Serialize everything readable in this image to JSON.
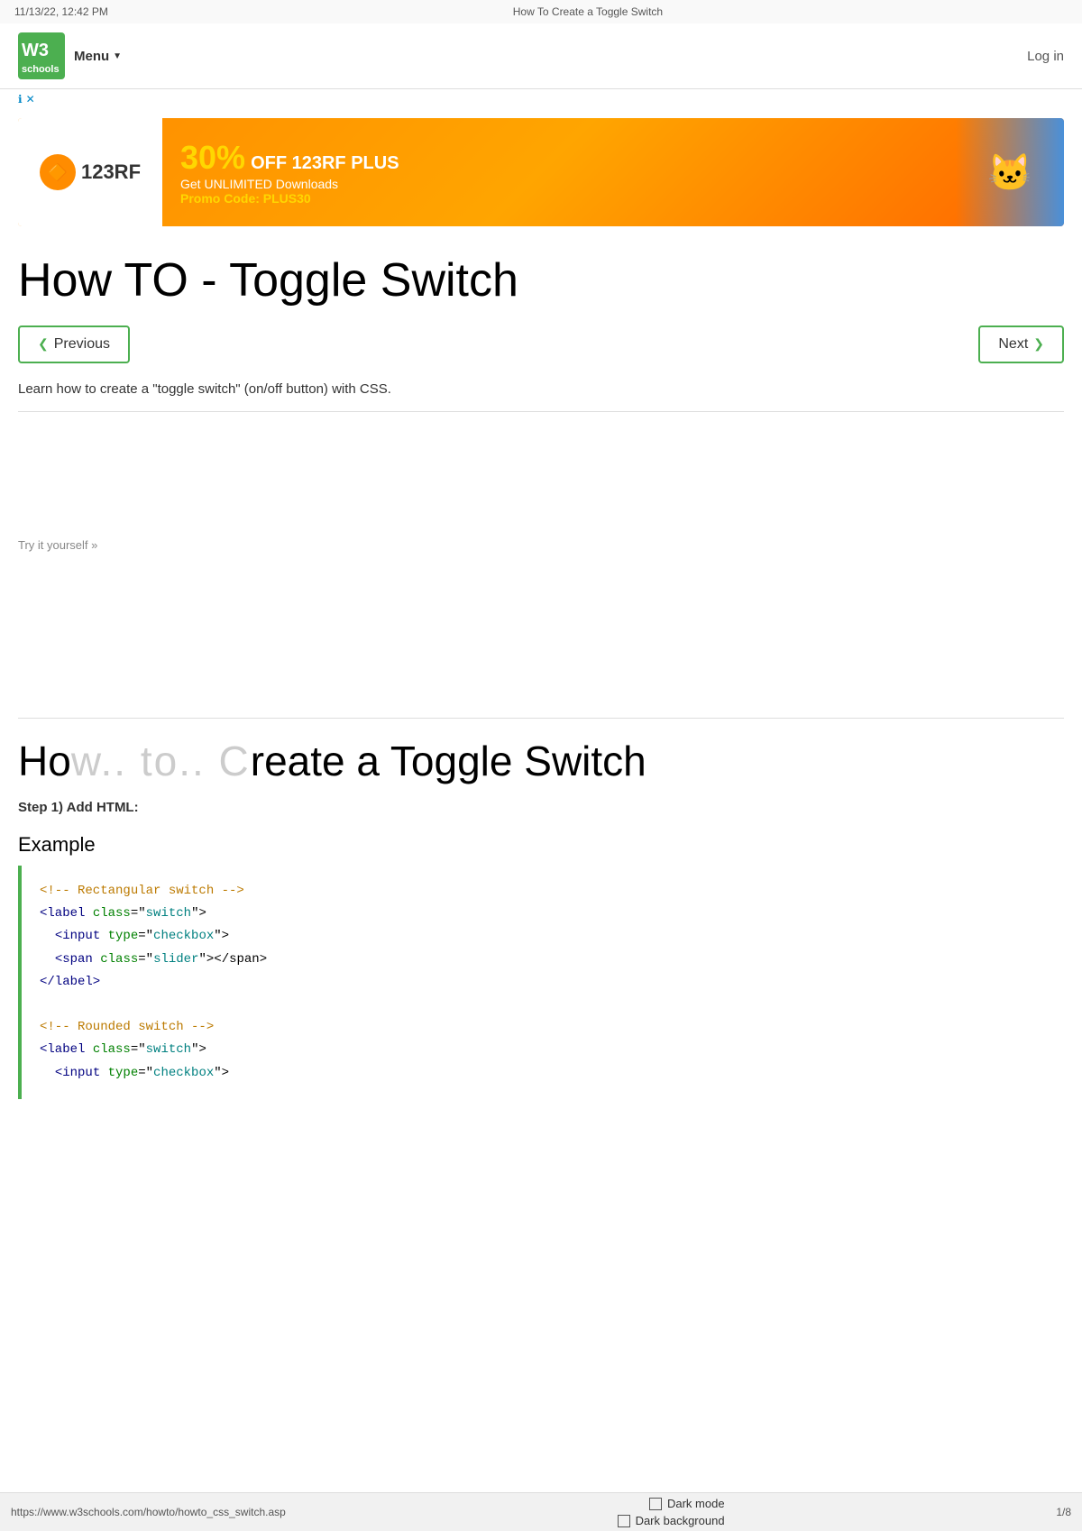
{
  "browser": {
    "date": "11/13/22, 12:42 PM",
    "page_title": "How To Create a Toggle Switch",
    "url": "https://www.w3schools.com/howto/howto_css_switch.asp",
    "page_num": "1/8"
  },
  "header": {
    "logo_text": "W³",
    "logo_sub": "schools",
    "menu_label": "Menu",
    "login_label": "Log in"
  },
  "ad_bar": {
    "info_icon": "ℹ",
    "close_icon": "✕"
  },
  "ad_banner": {
    "logo_text": "123RF",
    "discount": "30%",
    "off_text": "OFF 123RF PLUS",
    "subtitle": "Get UNLIMITED Downloads",
    "promo_label": "Promo Code:",
    "promo_code": "PLUS30"
  },
  "page": {
    "main_title": "How TO - Toggle Switch",
    "prev_label": "Previous",
    "next_label": "Next",
    "description": "Learn how to create a \"toggle switch\" (on/off button) with CSS.",
    "try_it_text": "Try it yourself »"
  },
  "howto": {
    "title_prefix": "Ho",
    "title_dots": "w.. to.. C",
    "title_suffix": "reate a Toggle Switch",
    "step1_label": "Step 1) Add HTML:",
    "example_label": "Example",
    "code_lines": [
      {
        "type": "comment",
        "text": "<!-- Rectangular switch -->"
      },
      {
        "type": "tag_open",
        "tag": "label",
        "attr": "class",
        "value": "switch"
      },
      {
        "type": "tag_open_indent",
        "tag": "input",
        "attr": "type",
        "value": "checkbox"
      },
      {
        "type": "tag_span",
        "attr": "class",
        "value": "slider"
      },
      {
        "type": "tag_close",
        "tag": "label"
      },
      {
        "type": "blank"
      },
      {
        "type": "comment",
        "text": "<!-- Rounded switch -->"
      },
      {
        "type": "tag_open",
        "tag": "label",
        "attr": "class",
        "value": "switch"
      },
      {
        "type": "tag_open_indent",
        "tag": "input",
        "attr": "type",
        "value": "checkbox"
      }
    ]
  },
  "status": {
    "dark_mode_label": "Dark mode",
    "second_option_label": "Dark background",
    "url": "https://www.w3schools.com/howto/howto_css_switch.asp"
  },
  "colors": {
    "green": "#4caf50",
    "orange": "#ff8c00",
    "navy": "#000080",
    "teal": "#008080",
    "dark_green": "#008000",
    "brown": "#bc7a00"
  }
}
